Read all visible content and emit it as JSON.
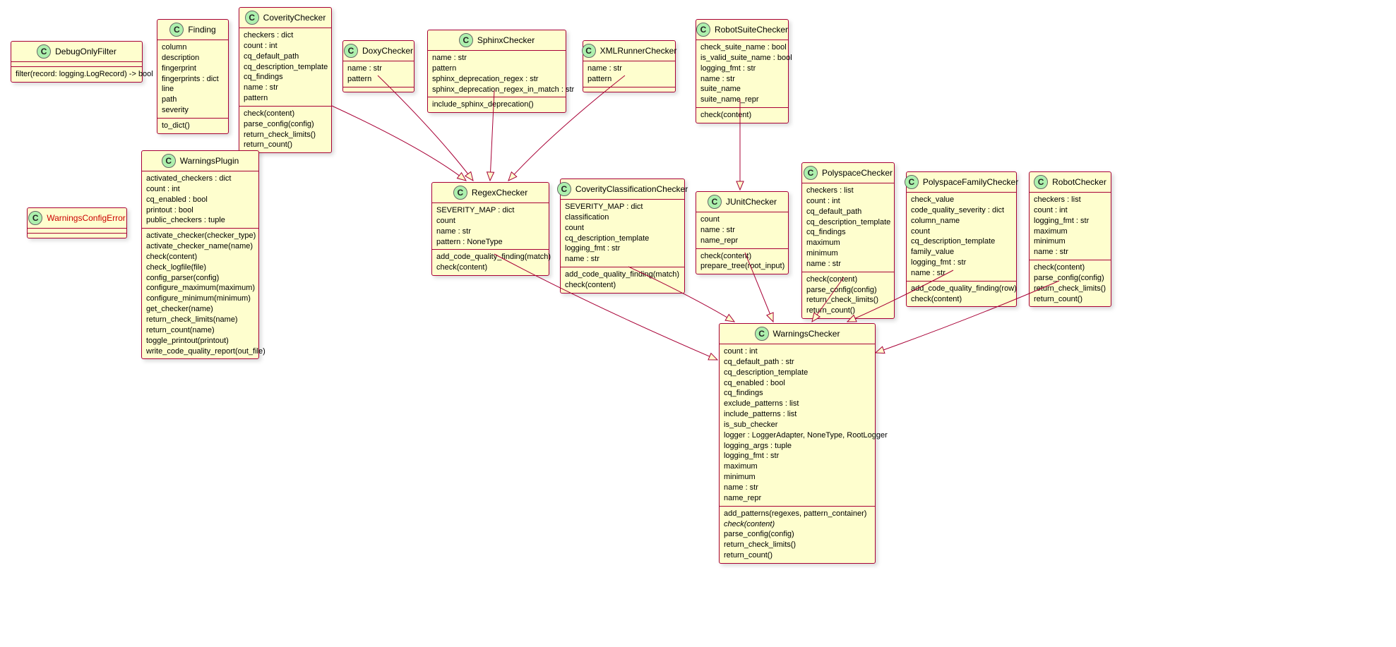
{
  "classes": {
    "DebugOnlyFilter": {
      "name": "DebugOnlyFilter",
      "attrs": [],
      "methods": [
        "filter(record: logging.LogRecord) -> bool"
      ]
    },
    "Finding": {
      "name": "Finding",
      "attrs": [
        "column",
        "description",
        "fingerprint",
        "fingerprints : dict",
        "line",
        "path",
        "severity"
      ],
      "methods": [
        "to_dict()"
      ]
    },
    "CoverityChecker": {
      "name": "CoverityChecker",
      "attrs": [
        "checkers : dict",
        "count : int",
        "cq_default_path",
        "cq_description_template",
        "cq_findings",
        "name : str",
        "pattern"
      ],
      "methods": [
        "check(content)",
        "parse_config(config)",
        "return_check_limits()",
        "return_count()"
      ]
    },
    "DoxyChecker": {
      "name": "DoxyChecker",
      "attrs": [
        "name : str",
        "pattern"
      ],
      "methods": []
    },
    "SphinxChecker": {
      "name": "SphinxChecker",
      "attrs": [
        "name : str",
        "pattern",
        "sphinx_deprecation_regex : str",
        "sphinx_deprecation_regex_in_match : str"
      ],
      "methods": [
        "include_sphinx_deprecation()"
      ]
    },
    "XMLRunnerChecker": {
      "name": "XMLRunnerChecker",
      "attrs": [
        "name : str",
        "pattern"
      ],
      "methods": []
    },
    "RobotSuiteChecker": {
      "name": "RobotSuiteChecker",
      "attrs": [
        "check_suite_name : bool",
        "is_valid_suite_name : bool",
        "logging_fmt : str",
        "name : str",
        "suite_name",
        "suite_name_repr"
      ],
      "methods": [
        "check(content)"
      ]
    },
    "WarningsConfigError": {
      "name": "WarningsConfigError",
      "attrs": [],
      "methods": []
    },
    "WarningsPlugin": {
      "name": "WarningsPlugin",
      "attrs": [
        "activated_checkers : dict",
        "count : int",
        "cq_enabled : bool",
        "printout : bool",
        "public_checkers : tuple"
      ],
      "methods": [
        "activate_checker(checker_type)",
        "activate_checker_name(name)",
        "check(content)",
        "check_logfile(file)",
        "config_parser(config)",
        "configure_maximum(maximum)",
        "configure_minimum(minimum)",
        "get_checker(name)",
        "return_check_limits(name)",
        "return_count(name)",
        "toggle_printout(printout)",
        "write_code_quality_report(out_file)"
      ]
    },
    "RegexChecker": {
      "name": "RegexChecker",
      "attrs": [
        "SEVERITY_MAP : dict",
        "count",
        "name : str",
        "pattern : NoneType"
      ],
      "methods": [
        "add_code_quality_finding(match)",
        "check(content)"
      ]
    },
    "CoverityClassificationChecker": {
      "name": "CoverityClassificationChecker",
      "attrs": [
        "SEVERITY_MAP : dict",
        "classification",
        "count",
        "cq_description_template",
        "logging_fmt : str",
        "name : str"
      ],
      "methods": [
        "add_code_quality_finding(match)",
        "check(content)"
      ]
    },
    "JUnitChecker": {
      "name": "JUnitChecker",
      "attrs": [
        "count",
        "name : str",
        "name_repr"
      ],
      "methods": [
        "check(content)",
        "prepare_tree(root_input)"
      ]
    },
    "PolyspaceChecker": {
      "name": "PolyspaceChecker",
      "attrs": [
        "checkers : list",
        "count : int",
        "cq_default_path",
        "cq_description_template",
        "cq_findings",
        "maximum",
        "minimum",
        "name : str"
      ],
      "methods": [
        "check(content)",
        "parse_config(config)",
        "return_check_limits()",
        "return_count()"
      ]
    },
    "PolyspaceFamilyChecker": {
      "name": "PolyspaceFamilyChecker",
      "attrs": [
        "check_value",
        "code_quality_severity : dict",
        "column_name",
        "count",
        "cq_description_template",
        "family_value",
        "logging_fmt : str",
        "name : str"
      ],
      "methods": [
        "add_code_quality_finding(row)",
        "check(content)"
      ]
    },
    "RobotChecker": {
      "name": "RobotChecker",
      "attrs": [
        "checkers : list",
        "count : int",
        "logging_fmt : str",
        "maximum",
        "minimum",
        "name : str"
      ],
      "methods": [
        "check(content)",
        "parse_config(config)",
        "return_check_limits()",
        "return_count()"
      ]
    },
    "WarningsChecker": {
      "name": "WarningsChecker",
      "attrs": [
        "count : int",
        "cq_default_path : str",
        "cq_description_template",
        "cq_enabled : bool",
        "cq_findings",
        "exclude_patterns : list",
        "include_patterns : list",
        "is_sub_checker",
        "logger : LoggerAdapter, NoneType, RootLogger",
        "logging_args : tuple",
        "logging_fmt : str",
        "maximum",
        "minimum",
        "name : str",
        "name_repr"
      ],
      "methods": [
        "add_patterns(regexes, pattern_container)",
        "check(content)",
        "parse_config(config)",
        "return_check_limits()",
        "return_count()"
      ]
    }
  }
}
